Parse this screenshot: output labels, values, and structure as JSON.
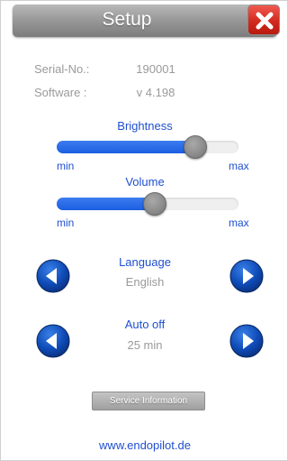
{
  "header": {
    "title": "Setup",
    "close_icon": "close-x-icon"
  },
  "info": {
    "serial_label": "Serial-No.:",
    "serial_value": "190001",
    "software_label": "Software :",
    "software_value": "v 4.198"
  },
  "brightness": {
    "label": "Brightness",
    "min_label": "min",
    "max_label": "max",
    "level": 0.76
  },
  "volume": {
    "label": "Volume",
    "min_label": "min",
    "max_label": "max",
    "level": 0.54
  },
  "language": {
    "label": "Language",
    "value": "English",
    "prev_icon": "arrow-left-icon",
    "next_icon": "arrow-right-icon"
  },
  "auto_off": {
    "label": "Auto off",
    "value": "25 min",
    "prev_icon": "arrow-left-icon",
    "next_icon": "arrow-right-icon"
  },
  "service_button_label": "Service Information",
  "website": "www.endopilot.de",
  "colors": {
    "accent_blue": "#1f4fd0",
    "close_red": "#d22a1f",
    "title_grey": "#9a9a9a"
  }
}
